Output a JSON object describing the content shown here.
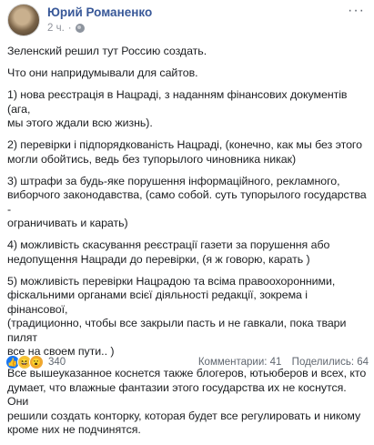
{
  "post": {
    "author": "Юрий Романенко",
    "time": "2 ч.",
    "separator": "·",
    "more": "···",
    "paragraphs": [
      "Зеленский решил тут Россию создать.",
      "Что они напридумывали для сайтов.",
      "1) нова реєстрація в Нацраді, з наданням фінансових документів (ага,\nмы этого ждали всю жизнь).",
      "2) перевірки і підпорядкованість Нацраді, (конечно, как мы без этого\nмогли обойтись, ведь без тупорылого чиновника никак)",
      "3) штрафи за будь-яке порушення інформаційного, рекламного,\nвиборчого законодавства, (само собой. суть тупорылого государства -\nограничивать и карать)",
      "4) можливість скасування реєстрації газети за порушення або\nнедопущення Нацради до перевірки, (я ж говорю, карать )",
      "5) можливість перевірки Нацрадою та всіма правоохоронними,\nфіскальними органами всієї діяльності редакції, зокрема і фінансової,\n(традиционно, чтобы все закрыли пасть и не гавкали, пока твари пилят\nвсе на своем пути.. )",
      "Все вышеуказанное коснется также блогеров, ютьюберов и всех, кто\nдумает, что влажные фантазии этого государства их не коснутся. Они\nрешили создать конторку, которая будет все регулировать и никому\nкроме них не подчинятся."
    ]
  },
  "footer": {
    "reaction_icons": [
      "like-icon",
      "haha-icon",
      "wow-icon"
    ],
    "reactions_count": "340",
    "comments": "Комментарии: 41",
    "shares": "Поделились: 64"
  },
  "colors": {
    "author_link": "#385898",
    "muted": "#90949c",
    "like": "#1877f2"
  }
}
